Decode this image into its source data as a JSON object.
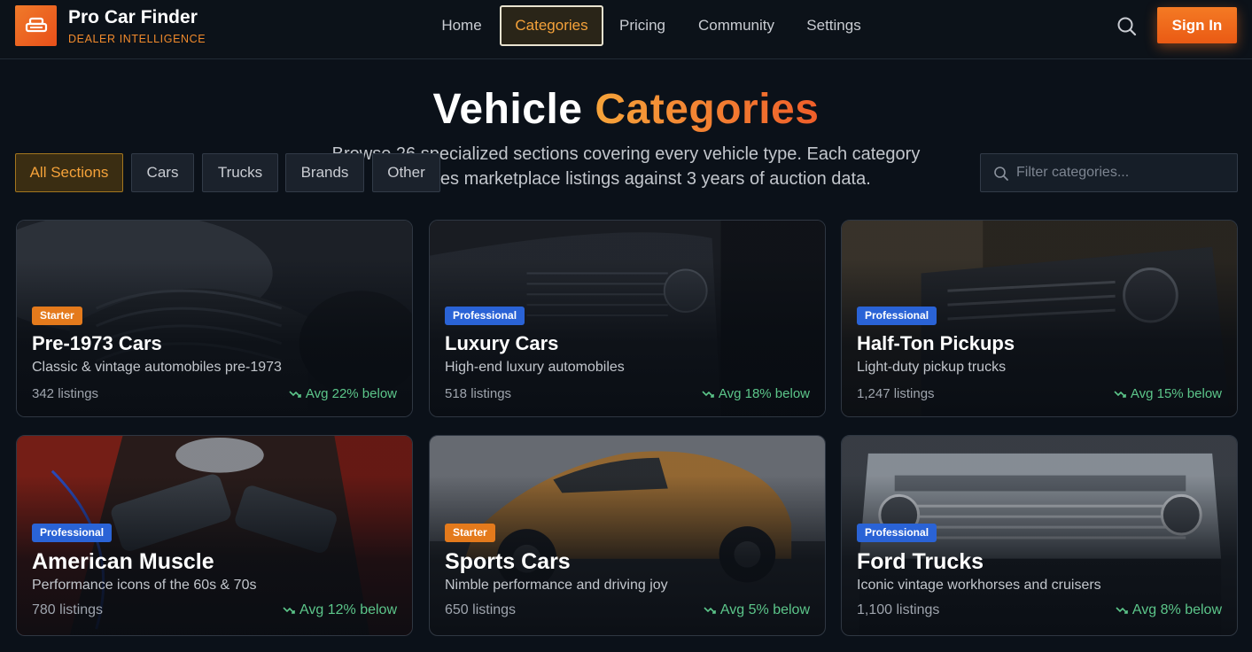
{
  "brand": {
    "title": "Pro Car Finder",
    "subtitle": "DEALER INTELLIGENCE",
    "logo_icon": "car-icon"
  },
  "nav": [
    {
      "label": "Home",
      "active": false
    },
    {
      "label": "Categories",
      "active": true
    },
    {
      "label": "Pricing",
      "active": false
    },
    {
      "label": "Community",
      "active": false
    },
    {
      "label": "Settings",
      "active": false
    }
  ],
  "header": {
    "search_icon": "search-icon",
    "signin_label": "Sign In"
  },
  "hero": {
    "title_main": "Vehicle",
    "title_accent": "Categories",
    "description": "Browse 26 specialized sections covering every vehicle type. Each category compares marketplace listings against 3 years of auction data."
  },
  "filters": {
    "chips": [
      {
        "label": "All Sections",
        "active": true
      },
      {
        "label": "Cars",
        "active": false
      },
      {
        "label": "Trucks",
        "active": false
      },
      {
        "label": "Brands",
        "active": false
      },
      {
        "label": "Other",
        "active": false
      }
    ],
    "search_placeholder": "Filter categories...",
    "search_value": ""
  },
  "cards": [
    {
      "tier": "Starter",
      "title": "Pre-1973 Cars",
      "desc": "Classic & vintage automobiles pre-1973",
      "listings": "342 listings",
      "trend": "Avg 22% below",
      "trend_icon": "trend-down-icon"
    },
    {
      "tier": "Professional",
      "title": "Luxury Cars",
      "desc": "High-end luxury automobiles",
      "listings": "518 listings",
      "trend": "Avg 18% below",
      "trend_icon": "trend-down-icon"
    },
    {
      "tier": "Professional",
      "title": "Half-Ton Pickups",
      "desc": "Light-duty pickup trucks",
      "listings": "1,247 listings",
      "trend": "Avg 15% below",
      "trend_icon": "trend-down-icon"
    },
    {
      "tier": "Professional",
      "title": "American Muscle",
      "desc": "Performance icons of the 60s & 70s",
      "listings": "780 listings",
      "trend": "Avg 12% below",
      "trend_icon": "trend-down-icon"
    },
    {
      "tier": "Starter",
      "title": "Sports Cars",
      "desc": "Nimble performance and driving joy",
      "listings": "650 listings",
      "trend": "Avg 5% below",
      "trend_icon": "trend-down-icon"
    },
    {
      "tier": "Professional",
      "title": "Ford Trucks",
      "desc": "Iconic vintage workhorses and cruisers",
      "listings": "1,100 listings",
      "trend": "Avg 8% below",
      "trend_icon": "trend-down-icon"
    }
  ],
  "colors": {
    "accent": "#f07a2a",
    "trend": "#5cc68a",
    "pro_badge": "#2a63d6",
    "starter_badge": "#e47a1c"
  }
}
